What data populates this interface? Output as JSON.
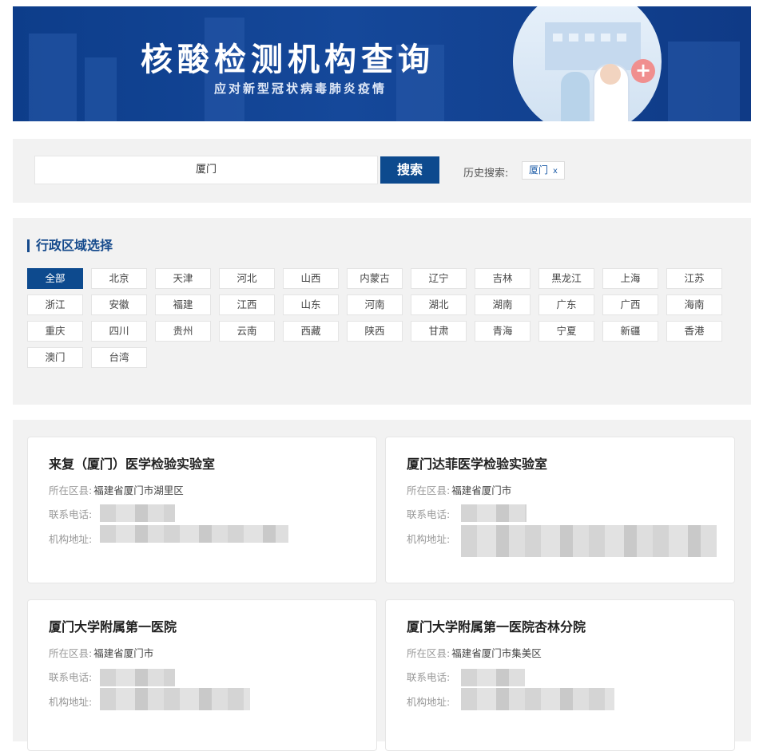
{
  "banner": {
    "title": "核酸检测机构查询",
    "subtitle": "应对新型冠状病毒肺炎疫情"
  },
  "search": {
    "value": "厦门",
    "button_label": "搜索",
    "history_label": "历史搜索:",
    "history_items": [
      "厦门"
    ],
    "history_remove_glyph": "x"
  },
  "region": {
    "title": "行政区域选择",
    "active": "全部",
    "items": [
      "全部",
      "北京",
      "天津",
      "河北",
      "山西",
      "内蒙古",
      "辽宁",
      "吉林",
      "黑龙江",
      "上海",
      "江苏",
      "浙江",
      "安徽",
      "福建",
      "江西",
      "山东",
      "河南",
      "湖北",
      "湖南",
      "广东",
      "广西",
      "海南",
      "重庆",
      "四川",
      "贵州",
      "云南",
      "西藏",
      "陕西",
      "甘肃",
      "青海",
      "宁夏",
      "新疆",
      "香港",
      "澳门",
      "台湾"
    ]
  },
  "results": {
    "labels": {
      "district": "所在区县:",
      "phone": "联系电话:",
      "address": "机构地址:"
    },
    "cards": [
      {
        "name": "来复（厦门）医学检验实验室",
        "district": "福建省厦门市湖里区"
      },
      {
        "name": "厦门达菲医学检验实验室",
        "district": "福建省厦门市"
      },
      {
        "name": "厦门大学附属第一医院",
        "district": "福建省厦门市"
      },
      {
        "name": "厦门大学附属第一医院杏林分院",
        "district": "福建省厦门市集美区"
      }
    ]
  },
  "colors": {
    "brand": "#0d4a8e",
    "panel_bg": "#f2f2f2"
  }
}
